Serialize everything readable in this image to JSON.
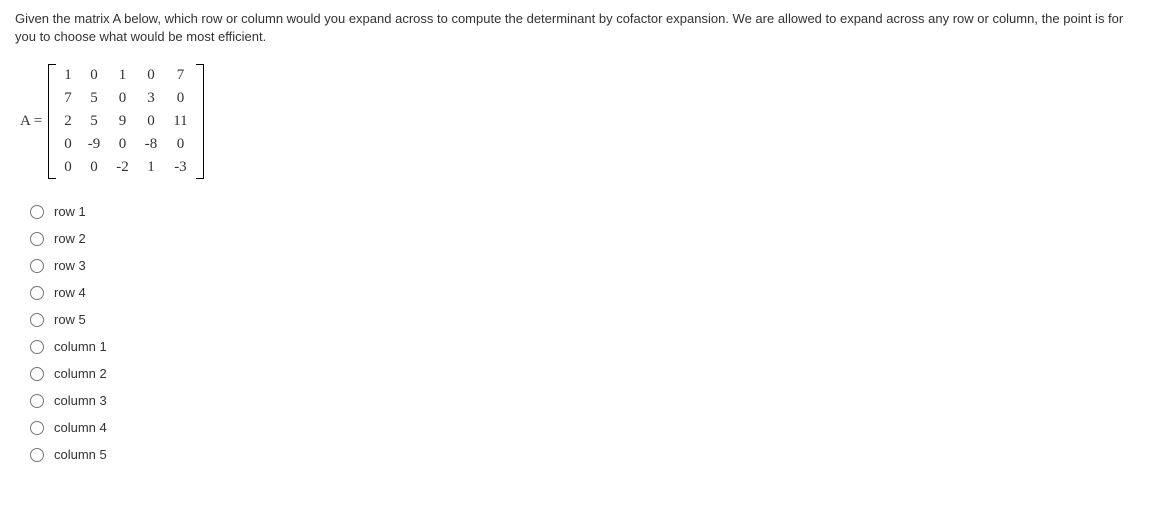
{
  "question": "Given the matrix A below, which row or column would you expand across to compute the determinant by cofactor expansion. We are allowed to expand across any row or column, the point is for you to choose what would be most efficient.",
  "matrix_label": "A =",
  "matrix": [
    [
      "1",
      "0",
      "1",
      "0",
      "7"
    ],
    [
      "7",
      "5",
      "0",
      "3",
      "0"
    ],
    [
      "2",
      "5",
      "9",
      "0",
      "11"
    ],
    [
      "0",
      "-9",
      "0",
      "-8",
      "0"
    ],
    [
      "0",
      "0",
      "-2",
      "1",
      "-3"
    ]
  ],
  "options": [
    "row 1",
    "row 2",
    "row 3",
    "row 4",
    "row 5",
    "column 1",
    "column 2",
    "column 3",
    "column 4",
    "column 5"
  ]
}
